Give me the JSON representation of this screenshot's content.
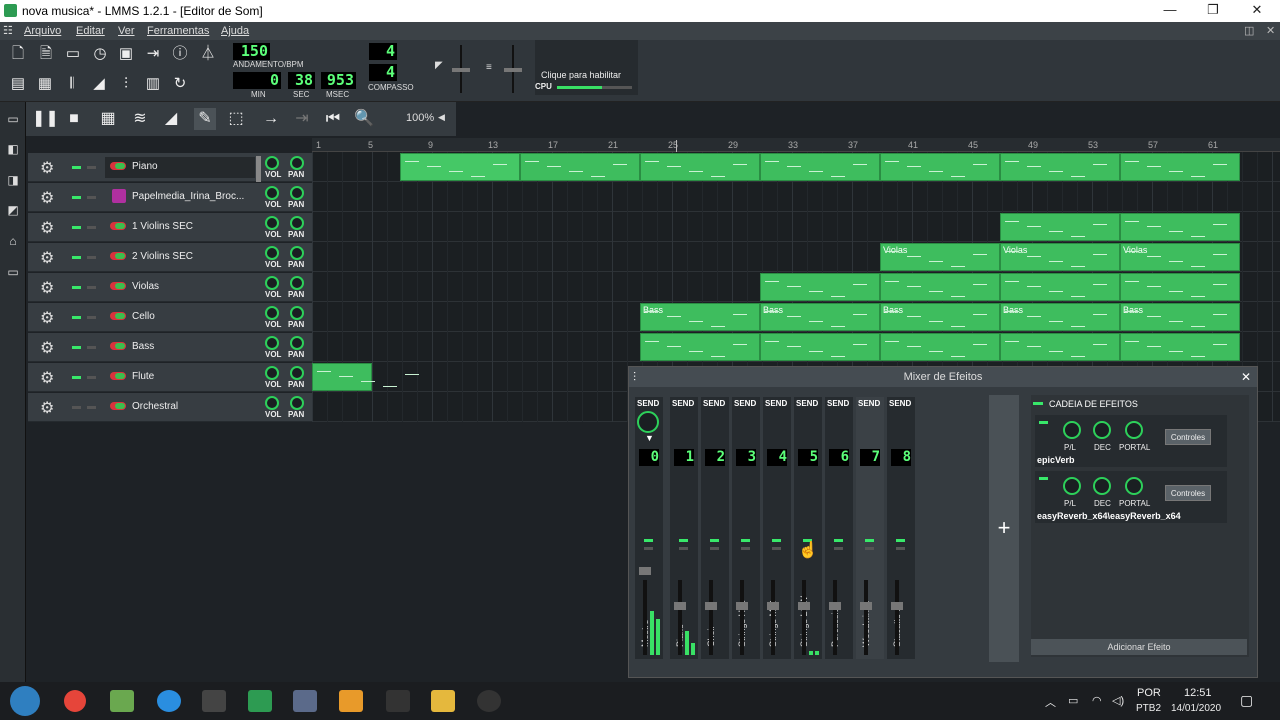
{
  "window": {
    "title": "nova musica* - LMMS 1.2.1 - [Editor de Som]",
    "minimize": "—",
    "maximize": "❐",
    "close": "✕"
  },
  "menu": [
    "Arquivo",
    "Editar",
    "Ver",
    "Ferramentas",
    "Ajuda"
  ],
  "toolbar": {
    "tempo": "150",
    "tempo_label": "ANDAMENTO/BPM",
    "time_min": "0",
    "time_sec": "38",
    "time_msec": "953",
    "min_label": "MIN",
    "sec_label": "SEC",
    "msec_label": "MSEC",
    "sig_num": "4",
    "sig_den": "4",
    "sig_label": "COMPASSO",
    "cpu_hint": "Clique para habilitar",
    "cpu_label": "CPU"
  },
  "song_toolbar": {
    "zoom": "100%"
  },
  "ruler": [
    "1",
    "5",
    "9",
    "13",
    "17",
    "21",
    "25",
    "29",
    "33",
    "37",
    "41",
    "45",
    "49",
    "53",
    "57",
    "61"
  ],
  "tracks": [
    {
      "name": "Piano",
      "vol": "VOL",
      "pan": "PAN",
      "icon": "instrument",
      "muted": false
    },
    {
      "name": "Papelmedia_Irina_Broc...",
      "vol": "VOL",
      "pan": "PAN",
      "icon": "sample",
      "muted": false
    },
    {
      "name": "1 Violins SEC",
      "vol": "VOL",
      "pan": "PAN",
      "icon": "instrument",
      "muted": false
    },
    {
      "name": "2 Violins SEC",
      "vol": "VOL",
      "pan": "PAN",
      "icon": "instrument",
      "muted": false
    },
    {
      "name": "Violas",
      "vol": "VOL",
      "pan": "PAN",
      "icon": "instrument",
      "muted": false
    },
    {
      "name": "Cello",
      "vol": "VOL",
      "pan": "PAN",
      "icon": "instrument",
      "muted": false
    },
    {
      "name": "Bass",
      "vol": "VOL",
      "pan": "PAN",
      "icon": "instrument",
      "muted": false
    },
    {
      "name": "Flute",
      "vol": "VOL",
      "pan": "PAN",
      "icon": "instrument",
      "muted": false
    },
    {
      "name": "Orchestral",
      "vol": "VOL",
      "pan": "PAN",
      "icon": "instrument",
      "muted": true
    }
  ],
  "clip_labels": {
    "violas": "Violas",
    "bass": "Bass"
  },
  "mixer": {
    "title": "Mixer de Efeitos",
    "close": "✕",
    "send": "SEND",
    "add_channel": "+",
    "channels": [
      {
        "num": "0",
        "name": "Mestre"
      },
      {
        "num": "1",
        "name": "Piano"
      },
      {
        "num": "2",
        "name": "Choir"
      },
      {
        "num": "3",
        "name": "Strings HI..."
      },
      {
        "num": "4",
        "name": "Strings MID"
      },
      {
        "num": "5",
        "name": "Strings LOW"
      },
      {
        "num": "6",
        "name": "Percussion"
      },
      {
        "num": "7",
        "name": "Woodwinds"
      },
      {
        "num": "8",
        "name": "Stacatto ..."
      }
    ],
    "fx_chain_title": "CADEIA DE EFEITOS",
    "effects": [
      {
        "name": "epicVerb",
        "k1": "P/L",
        "k2": "DEC",
        "k3": "PORTAL",
        "controls": "Controles"
      },
      {
        "name": "easyReverb_x64\\easyReverb_x64",
        "k1": "P/L",
        "k2": "DEC",
        "k3": "PORTAL",
        "controls": "Controles"
      }
    ],
    "add_effect": "Adicionar Efeito"
  },
  "taskbar": {
    "lang1": "POR",
    "lang2": "PTB2",
    "time": "12:51",
    "date": "14/01/2020"
  }
}
